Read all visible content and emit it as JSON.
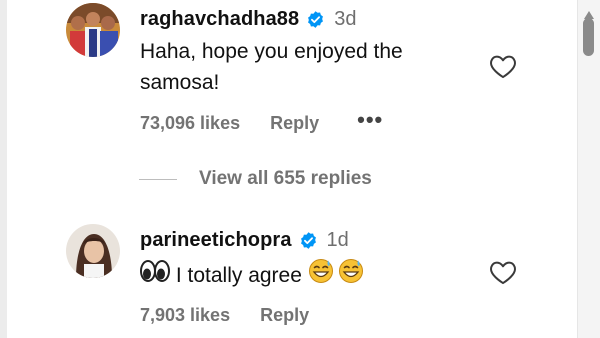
{
  "comments": [
    {
      "username": "raghavchadha88",
      "age": "3d",
      "text_lines": [
        "Haha, hope you enjoyed the",
        "samosa!"
      ],
      "likes": "73,096 likes",
      "reply": "Reply",
      "more": "•••"
    },
    {
      "username": "parineetichopra",
      "age": "1d",
      "text": " I totally agree ",
      "likes": "7,903 likes",
      "reply": "Reply"
    }
  ],
  "view_replies": "View all 655 replies",
  "icons": {
    "verified": "verified-badge-icon",
    "like": "heart-outline-icon",
    "emoji_eyes": "eyes-emoji-icon",
    "emoji_sweat": "grinning-sweat-emoji-icon"
  },
  "colors": {
    "verified_blue": "#0095f6",
    "meta_gray": "#737373",
    "text": "#111111"
  }
}
